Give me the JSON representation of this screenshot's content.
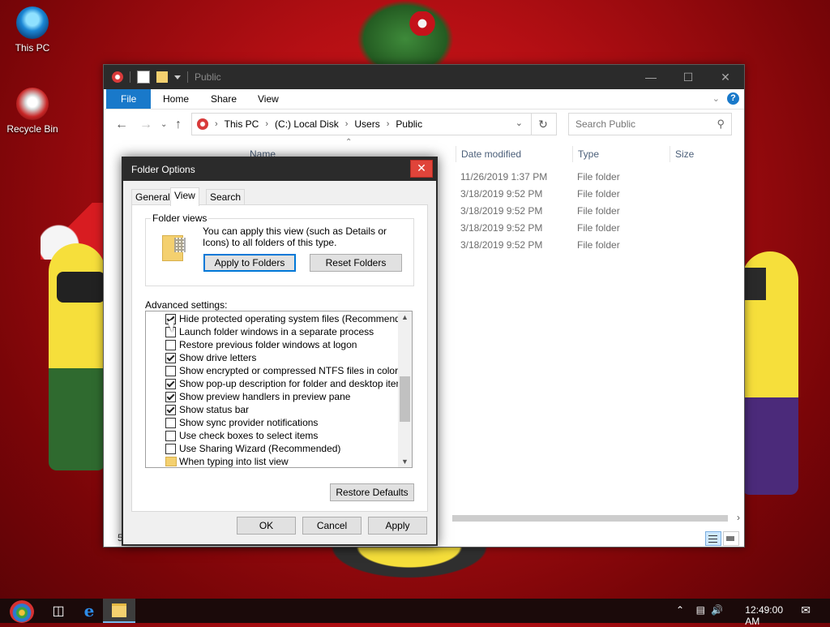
{
  "desktop": {
    "icons": [
      {
        "label": "This PC"
      },
      {
        "label": "Recycle Bin"
      }
    ]
  },
  "explorer": {
    "title": "Public",
    "ribbon_tabs": [
      "File",
      "Home",
      "Share",
      "View"
    ],
    "breadcrumb": [
      "This PC",
      "(C:) Local Disk",
      "Users",
      "Public"
    ],
    "search_placeholder": "Search Public",
    "columns": [
      "Name",
      "Date modified",
      "Type",
      "Size"
    ],
    "rows": [
      {
        "date": "11/26/2019 1:37 PM",
        "type": "File folder"
      },
      {
        "date": "3/18/2019 9:52 PM",
        "type": "File folder"
      },
      {
        "date": "3/18/2019 9:52 PM",
        "type": "File folder"
      },
      {
        "date": "3/18/2019 9:52 PM",
        "type": "File folder"
      },
      {
        "date": "3/18/2019 9:52 PM",
        "type": "File folder"
      }
    ],
    "status_count": "5"
  },
  "dialog": {
    "title": "Folder Options",
    "tabs": [
      "General",
      "View",
      "Search"
    ],
    "active_tab": "View",
    "folder_views": {
      "legend": "Folder views",
      "description": "You can apply this view (such as Details or Icons) to all folders of this type.",
      "apply_button": "Apply to Folders",
      "reset_button": "Reset Folders"
    },
    "advanced_label": "Advanced settings:",
    "advanced_items": [
      {
        "label": "Hide protected operating system files (Recommended)",
        "checked": true
      },
      {
        "label": "Launch folder windows in a separate process",
        "checked": false
      },
      {
        "label": "Restore previous folder windows at logon",
        "checked": false
      },
      {
        "label": "Show drive letters",
        "checked": true
      },
      {
        "label": "Show encrypted or compressed NTFS files in color",
        "checked": false
      },
      {
        "label": "Show pop-up description for folder and desktop items",
        "checked": true
      },
      {
        "label": "Show preview handlers in preview pane",
        "checked": true
      },
      {
        "label": "Show status bar",
        "checked": true
      },
      {
        "label": "Show sync provider notifications",
        "checked": false
      },
      {
        "label": "Use check boxes to select items",
        "checked": false
      },
      {
        "label": "Use Sharing Wizard (Recommended)",
        "checked": false
      },
      {
        "label": "When typing into list view",
        "folder": true
      }
    ],
    "restore_defaults": "Restore Defaults",
    "ok": "OK",
    "cancel": "Cancel",
    "apply": "Apply"
  },
  "taskbar": {
    "clock": "12:49:00 AM"
  },
  "colors": {
    "accent": "#1979ca",
    "titlebar": "#2b2b2b",
    "close_red": "#e0443a"
  }
}
